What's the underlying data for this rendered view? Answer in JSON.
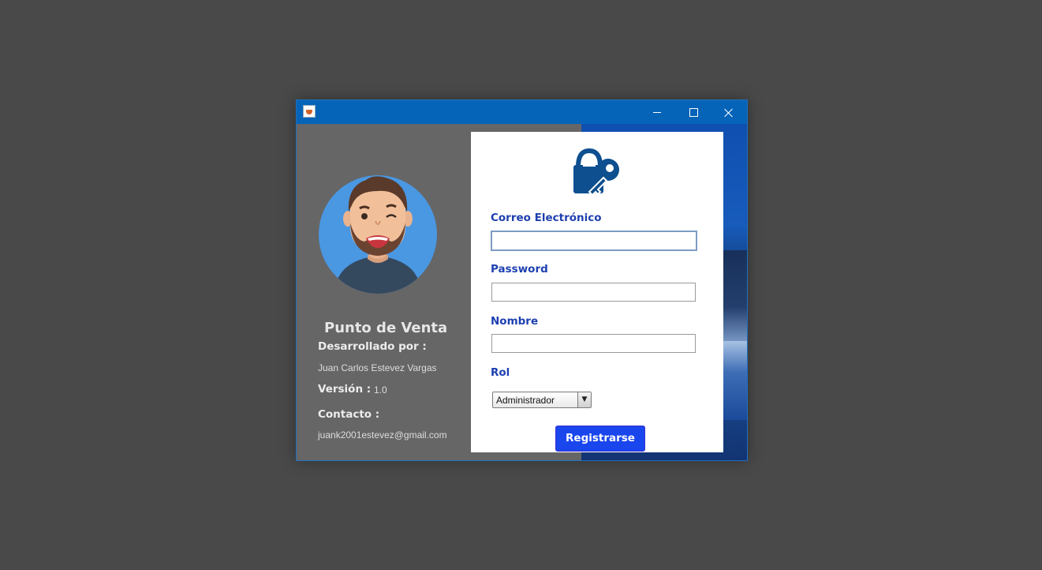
{
  "window": {
    "controls": {
      "minimize": "minimize",
      "maximize": "maximize",
      "close": "close"
    }
  },
  "sidebar": {
    "app_title": "Punto de Venta",
    "developed_by_label": "Desarrollado por :",
    "developer_name": "Juan Carlos Estevez Vargas",
    "version_label": "Versión :",
    "version_value": "1.0",
    "contact_label": "Contacto :",
    "contact_email": "juank2001estevez@gmail.com"
  },
  "form": {
    "email_label": "Correo Electrónico",
    "email_value": "",
    "password_label": "Password",
    "password_value": "",
    "name_label": "Nombre",
    "name_value": "",
    "role_label": "Rol",
    "role_selected": "Administrador",
    "submit_label": "Registrarse"
  },
  "colors": {
    "label_blue": "#1d3fb0",
    "button_blue": "#1a46ee",
    "titlebar_blue": "#0664b8",
    "sidebar_gray": "#666666"
  },
  "icons": [
    "java-app-icon",
    "avatar-icon",
    "lock-key-icon",
    "dropdown-arrow-icon"
  ]
}
